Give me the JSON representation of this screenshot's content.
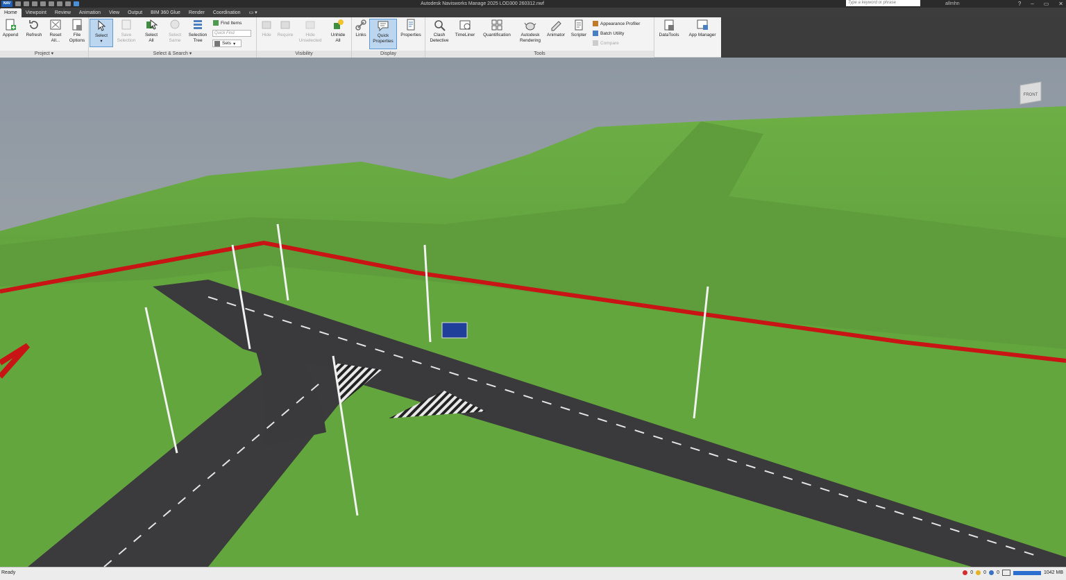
{
  "titlebar": {
    "app_logo": "NAV",
    "title": "Autodesk Navisworks Manage 2025   LOD300 260312.nwf",
    "search_placeholder": "Type a keyword or phrase",
    "user": "allmhn",
    "icons": [
      "save-icon",
      "open-icon",
      "undo-icon",
      "redo-icon",
      "print-icon"
    ]
  },
  "tabs": [
    {
      "label": "Home",
      "active": true
    },
    {
      "label": "Viewpoint"
    },
    {
      "label": "Review"
    },
    {
      "label": "Animation"
    },
    {
      "label": "View"
    },
    {
      "label": "Output"
    },
    {
      "label": "BIM 360 Glue"
    },
    {
      "label": "Render"
    },
    {
      "label": "Coordination"
    },
    {
      "label": "▭ ▾"
    }
  ],
  "ribbon": {
    "project": {
      "label": "Project ▾",
      "append": "Append",
      "refresh": "Refresh",
      "reset_all_1": "Reset",
      "reset_all_2": "All...",
      "file_options_1": "File",
      "file_options_2": "Options"
    },
    "select_search": {
      "label": "Select & Search ▾",
      "select": "Select",
      "save_selection_1": "Save",
      "save_selection_2": "Selection",
      "select_all_1": "Select",
      "select_all_2": "All",
      "select_same_1": "Select",
      "select_same_2": "Same",
      "selection_tree_1": "Selection",
      "selection_tree_2": "Tree",
      "find_items": "Find Items",
      "quick_find_placeholder": "Quick Find",
      "sets": "Sets"
    },
    "visibility": {
      "label": "Visibility",
      "hide": "Hide",
      "require": "Require",
      "hide_unselected_1": "Hide",
      "hide_unselected_2": "Unselected",
      "unhide_all_1": "Unhide",
      "unhide_all_2": "All"
    },
    "display": {
      "label": "Display",
      "links": "Links",
      "quick_properties_1": "Quick",
      "quick_properties_2": "Properties",
      "properties": "Properties"
    },
    "tools": {
      "label": "Tools",
      "clash_1": "Clash",
      "clash_2": "Detective",
      "timeliner": "TimeLiner",
      "quantification": "Quantification",
      "rendering_1": "Autodesk",
      "rendering_2": "Rendering",
      "animator": "Animator",
      "scripter": "Scripter",
      "appearance_profiler": "Appearance Profiler",
      "batch_utility": "Batch Utility",
      "compare": "Compare"
    },
    "datatools": "DataTools",
    "app_manager": "App Manager"
  },
  "viewcube": {
    "face": "FRONT"
  },
  "statusbar": {
    "status": "Ready",
    "memory": "1042 MB",
    "counts": [
      "0",
      "0",
      "0"
    ]
  },
  "colors": {
    "grass": "#5a9a3a",
    "road": "#3a3a3c",
    "boundary": "#c81414",
    "sky_top": "#8c97a2",
    "sky_bottom": "#a7a9ab",
    "accent": "#1f5fb8"
  }
}
